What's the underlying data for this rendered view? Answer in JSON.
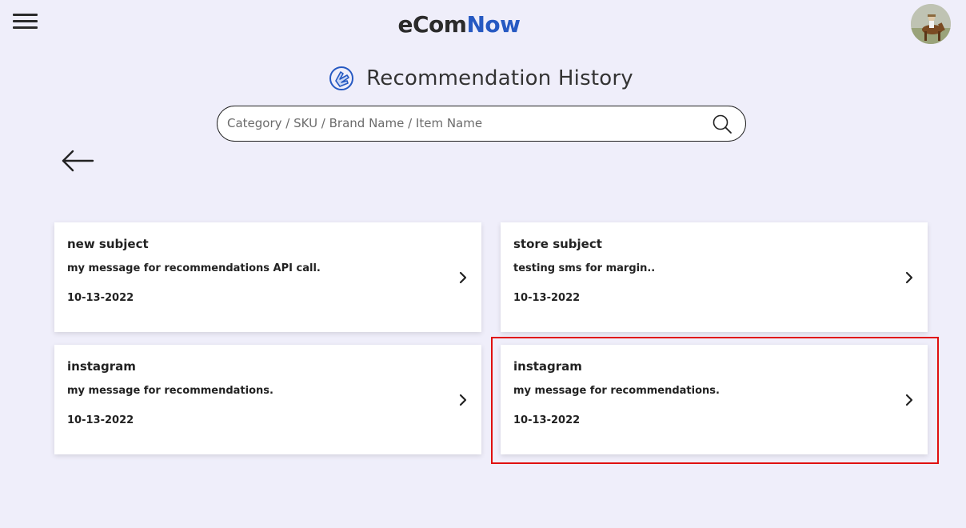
{
  "header": {
    "logo_part1": "eCom",
    "logo_part2": "Now",
    "menu_icon": "hamburger-menu-icon",
    "avatar_icon": "user-avatar"
  },
  "page": {
    "title": "Recommendation History",
    "title_icon": "recommendation-hand-icon"
  },
  "search": {
    "placeholder": "Category / SKU / Brand Name / Item Name",
    "value": "",
    "icon": "search-icon"
  },
  "back_icon": "back-arrow-icon",
  "cards": [
    {
      "subject": "new subject",
      "message": "my message for recommendations API call.",
      "date": "10-13-2022"
    },
    {
      "subject": "store subject",
      "message": "testing sms for margin..",
      "date": "10-13-2022"
    },
    {
      "subject": "instagram",
      "message": "my message for recommendations.",
      "date": "10-13-2022"
    },
    {
      "subject": "instagram",
      "message": "my message for recommendations.",
      "date": "10-13-2022"
    }
  ],
  "colors": {
    "background": "#efeefa",
    "brand_accent": "#2659c2",
    "highlight": "#e01010",
    "card_bg": "#ffffff"
  }
}
